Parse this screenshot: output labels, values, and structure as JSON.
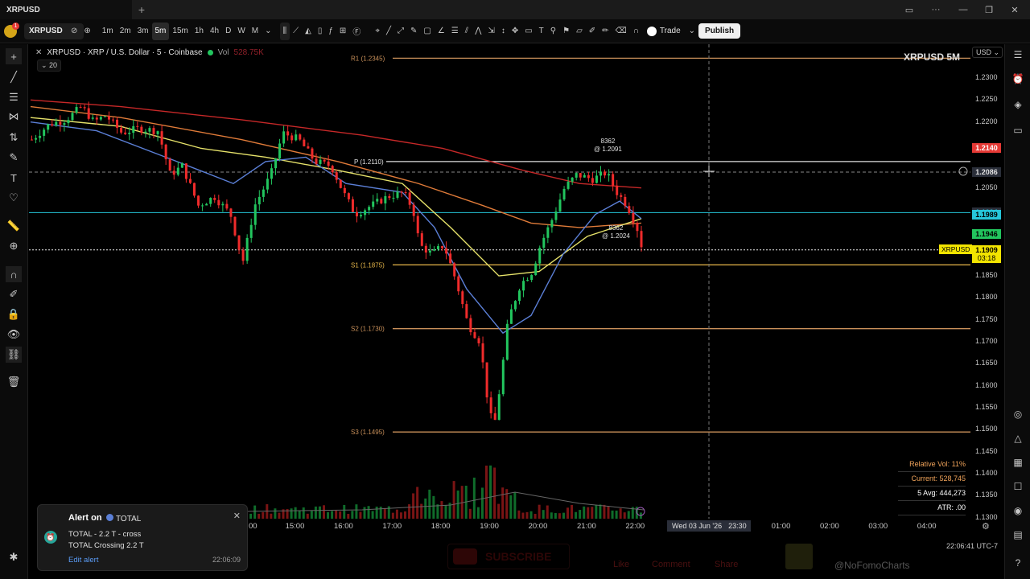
{
  "window": {
    "tab_title": "XRPUSD",
    "new_tab": "+"
  },
  "toolbar": {
    "symbol": "XRPUSD",
    "timeframes": [
      "1m",
      "2m",
      "3m",
      "5m",
      "15m",
      "1h",
      "4h",
      "D",
      "W",
      "M"
    ],
    "active_timeframe": "5m",
    "trade_label": "Trade",
    "publish_label": "Publish",
    "avatar_badge": "1"
  },
  "legend": {
    "title": "XRPUSD · XRP / U.S. Dollar · 5 · Coinbase",
    "vol_label": "Vol",
    "vol_value": "528.75K",
    "indicator_count": "20"
  },
  "chart": {
    "watermark": "XRPUSD 5M",
    "currency": "USD",
    "price_ticks": [
      "1.2300",
      "1.2250",
      "1.2200",
      "1.2050",
      "1.1850",
      "1.1800",
      "1.1750",
      "1.1700",
      "1.1650",
      "1.1600",
      "1.1550",
      "1.1500",
      "1.1450",
      "1.1400",
      "1.1350",
      "1.1300"
    ],
    "price_tick_values": [
      1.23,
      1.225,
      1.22,
      1.205,
      1.185,
      1.18,
      1.175,
      1.17,
      1.165,
      1.16,
      1.155,
      1.15,
      1.145,
      1.14,
      1.135,
      1.13
    ],
    "time_ticks": [
      "15:00",
      "16:00",
      "17:00",
      "18:00",
      "19:00",
      "20:00",
      "21:00",
      "22:00",
      "01:00",
      "02:00",
      "03:00",
      "04:00"
    ],
    "partial_time_tick": "00",
    "crosshair_time": "Wed 03 Jun '26",
    "crosshair_clock": "23:30",
    "pivots": [
      {
        "label": "R1 (1.2345)",
        "value": 1.2345,
        "color": "#c9905a"
      },
      {
        "label": "P (1.2110)",
        "value": 1.211,
        "color": "#e0e0e0"
      },
      {
        "label": "S1 (1.1875)",
        "value": 1.1875,
        "color": "#e8b84a"
      },
      {
        "label": "S2 (1.1730)",
        "value": 1.173,
        "color": "#c9905a"
      },
      {
        "label": "S3 (1.1495)",
        "value": 1.1495,
        "color": "#c9905a"
      }
    ],
    "price_labels": [
      {
        "text": "1.2140",
        "value": 1.214,
        "bg": "#e53935",
        "fg": "#ffffff"
      },
      {
        "text": "1.2086",
        "value": 1.2086,
        "bg": "#2a2e39",
        "fg": "#e0e0e0"
      },
      {
        "text": "1.1994",
        "value": 1.1994,
        "bg": "#2a2e39",
        "fg": "#26c6da"
      },
      {
        "text": "1.1989",
        "value": 1.1989,
        "bg": "#26c6da",
        "fg": "#000000"
      },
      {
        "text": "1.1946",
        "value": 1.1946,
        "bg": "#22c55e",
        "fg": "#000000"
      },
      {
        "text": "1.1909",
        "value": 1.1909,
        "bg": "#f2e400",
        "fg": "#000000"
      }
    ],
    "current_price_tag": "XRPUSD",
    "countdown": "03:18",
    "high_annotation": {
      "count": "8362",
      "price": "@ 1.2091"
    },
    "low_annotation": {
      "count": "8362",
      "price": "@ 1.2024"
    },
    "stats": {
      "relative_vol": "Relative Vol: 11%",
      "current": "Current: 528,745",
      "avg": "5 Avg: 444,273",
      "atr": "ATR: .00"
    },
    "colors": {
      "up": "#22c55e",
      "down": "#ef2b2b",
      "ma_red": "#c62828",
      "ma_orange": "#e07b39",
      "ma_yellow": "#e6e26a",
      "ma_blue": "#5b7fd6",
      "cyan": "#26c6da"
    }
  },
  "alert": {
    "title": "Alert on",
    "source": "TOTAL",
    "line1": "TOTAL - 2.2 T - cross",
    "line2": "TOTAL Crossing 2.2 T",
    "edit_link": "Edit alert",
    "time": "22:06:09"
  },
  "footer": {
    "clock": "22:06:41 UTC-7",
    "watermark_handle": "@NoFomoCharts",
    "subscribe": "SUBSCRIBE",
    "like": "Like",
    "comment": "Comment",
    "share": "Share"
  }
}
